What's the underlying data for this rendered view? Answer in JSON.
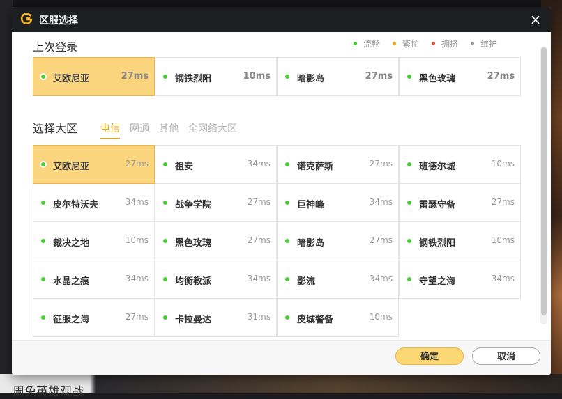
{
  "dialog": {
    "title": "区服选择",
    "close_symbol": "×"
  },
  "background": {
    "bottom_text": "周免英雄观战"
  },
  "legend": [
    {
      "label": "流畅",
      "color": "#44d02e"
    },
    {
      "label": "繁忙",
      "color": "#f0a820"
    },
    {
      "label": "拥挤",
      "color": "#e84a3a"
    },
    {
      "label": "维护",
      "color": "#999999"
    }
  ],
  "last_login": {
    "title": "上次登录",
    "servers": [
      {
        "name": "艾欧尼亚",
        "ping": "27ms",
        "status": "smooth",
        "selected": true
      },
      {
        "name": "钢铁烈阳",
        "ping": "10ms",
        "status": "smooth",
        "selected": false
      },
      {
        "name": "暗影岛",
        "ping": "27ms",
        "status": "smooth",
        "selected": false
      },
      {
        "name": "黑色玫瑰",
        "ping": "27ms",
        "status": "smooth",
        "selected": false
      }
    ]
  },
  "region_select": {
    "title": "选择大区",
    "tabs": [
      {
        "label": "电信",
        "active": true
      },
      {
        "label": "网通",
        "active": false
      },
      {
        "label": "其他",
        "active": false
      },
      {
        "label": "全网络大区",
        "active": false
      }
    ],
    "servers": [
      {
        "name": "艾欧尼亚",
        "ping": "27ms",
        "selected": true
      },
      {
        "name": "祖安",
        "ping": "34ms",
        "selected": false
      },
      {
        "name": "诺克萨斯",
        "ping": "27ms",
        "selected": false
      },
      {
        "name": "班德尔城",
        "ping": "10ms",
        "selected": false
      },
      {
        "name": "皮尔特沃夫",
        "ping": "34ms",
        "selected": false
      },
      {
        "name": "战争学院",
        "ping": "27ms",
        "selected": false
      },
      {
        "name": "巨神峰",
        "ping": "34ms",
        "selected": false
      },
      {
        "name": "雷瑟守备",
        "ping": "27ms",
        "selected": false
      },
      {
        "name": "裁决之地",
        "ping": "10ms",
        "selected": false
      },
      {
        "name": "黑色玫瑰",
        "ping": "27ms",
        "selected": false
      },
      {
        "name": "暗影岛",
        "ping": "27ms",
        "selected": false
      },
      {
        "name": "钢铁烈阳",
        "ping": "10ms",
        "selected": false
      },
      {
        "name": "水晶之痕",
        "ping": "34ms",
        "selected": false
      },
      {
        "name": "均衡教派",
        "ping": "34ms",
        "selected": false
      },
      {
        "name": "影流",
        "ping": "34ms",
        "selected": false
      },
      {
        "name": "守望之海",
        "ping": "34ms",
        "selected": false
      },
      {
        "name": "征服之海",
        "ping": "27ms",
        "selected": false
      },
      {
        "name": "卡拉曼达",
        "ping": "31ms",
        "selected": false
      },
      {
        "name": "皮城警备",
        "ping": "10ms",
        "selected": false
      }
    ]
  },
  "footer": {
    "confirm_label": "确定",
    "cancel_label": "取消"
  }
}
